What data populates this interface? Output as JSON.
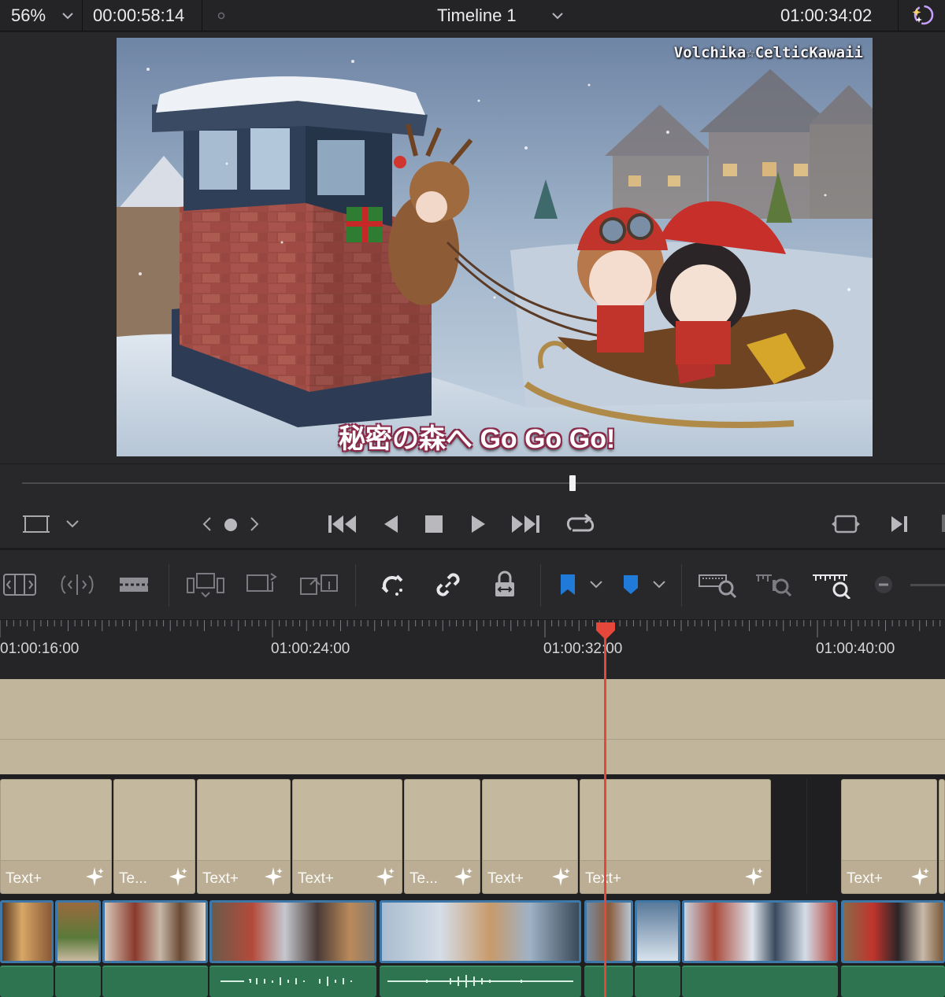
{
  "topbar": {
    "zoom": "56%",
    "duration_timecode": "00:00:58:14",
    "timeline_name": "Timeline 1",
    "current_timecode": "01:00:34:02"
  },
  "viewer": {
    "watermark": "Volchika☆CelticKawaii",
    "subtitle": "秘密の森へ Go Go Go!"
  },
  "transport": {
    "buttons": [
      "safe-area",
      "prev-marker",
      "marker",
      "next-marker",
      "jump-to-start",
      "play-reverse",
      "stop",
      "play",
      "jump-to-end",
      "loop",
      "match-frame",
      "next-edit"
    ]
  },
  "toolbar": {
    "tools": [
      "trim-edit",
      "dynamic-trim",
      "blade",
      "insert-clip",
      "overwrite-clip",
      "replace-clip",
      "snapping",
      "linked-selection",
      "position-lock",
      "flag",
      "marker",
      "zoom-full",
      "zoom-detail",
      "zoom-custom",
      "zoom-out"
    ],
    "flag_color": "#1f7ad8",
    "marker_color": "#1f7ad8"
  },
  "ruler": {
    "labels": [
      "01:00:16:00",
      "01:00:24:00",
      "01:00:32:00",
      "01:00:40:00"
    ]
  },
  "timeline": {
    "playhead_color": "#e5473b",
    "text_clips": [
      "Text+",
      "Te...",
      "Text+",
      "Text+",
      "Te...",
      "Text+",
      "Text+",
      "Text+"
    ],
    "text_clip_color": "#c4b89f",
    "audio_clip_color": "#2e7450",
    "video_clip_border": "#3e78a8"
  }
}
